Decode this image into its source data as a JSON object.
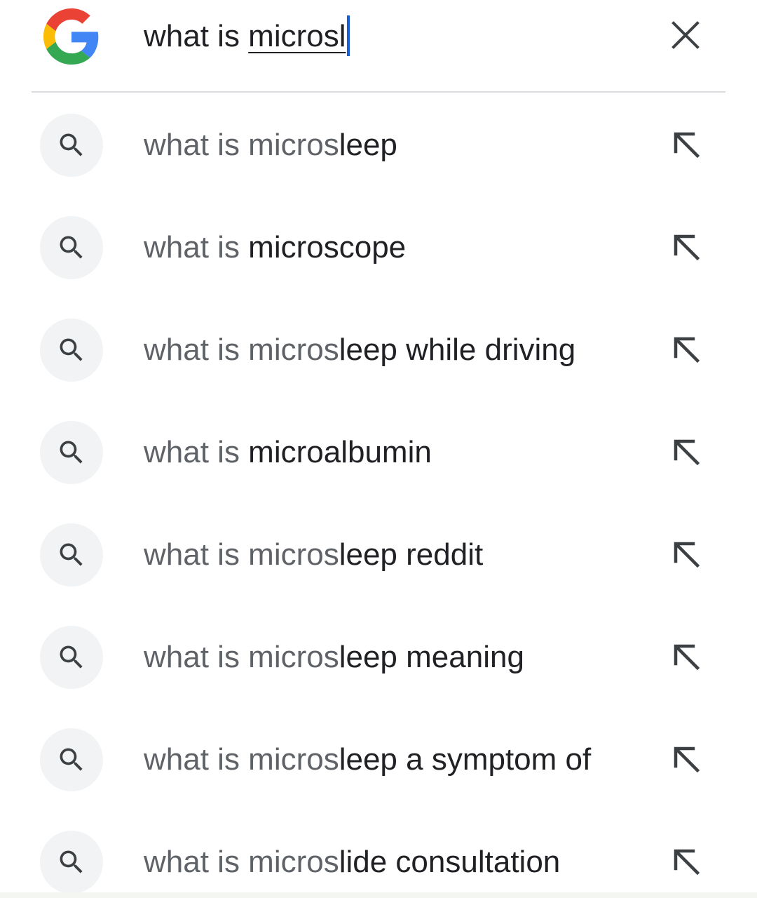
{
  "search": {
    "prefix": "what is ",
    "typed": "microsl",
    "logo_icon": "google-g-icon",
    "clear_icon": "close-icon",
    "caret_color": "#1a5fd0"
  },
  "colors": {
    "completion_text": "#202124",
    "prefix_text": "#5f6368",
    "icon_badge_bg": "#f1f3f4",
    "divider": "#dadce0"
  },
  "suggestions": [
    {
      "prefix": "what is micros",
      "completion": "leep",
      "icon": "search-icon",
      "action_icon": "arrow-up-left-icon"
    },
    {
      "prefix": "what is ",
      "completion": "microscope",
      "icon": "search-icon",
      "action_icon": "arrow-up-left-icon"
    },
    {
      "prefix": "what is micros",
      "completion": "leep while driving",
      "icon": "search-icon",
      "action_icon": "arrow-up-left-icon"
    },
    {
      "prefix": "what is ",
      "completion": "microalbumin",
      "icon": "search-icon",
      "action_icon": "arrow-up-left-icon"
    },
    {
      "prefix": "what is micros",
      "completion": "leep reddit",
      "icon": "search-icon",
      "action_icon": "arrow-up-left-icon"
    },
    {
      "prefix": "what is micros",
      "completion": "leep meaning",
      "icon": "search-icon",
      "action_icon": "arrow-up-left-icon"
    },
    {
      "prefix": "what is micros",
      "completion": "leep a symptom of",
      "icon": "search-icon",
      "action_icon": "arrow-up-left-icon"
    },
    {
      "prefix": "what is micros",
      "completion": "lide consultation",
      "icon": "search-icon",
      "action_icon": "arrow-up-left-icon"
    }
  ]
}
